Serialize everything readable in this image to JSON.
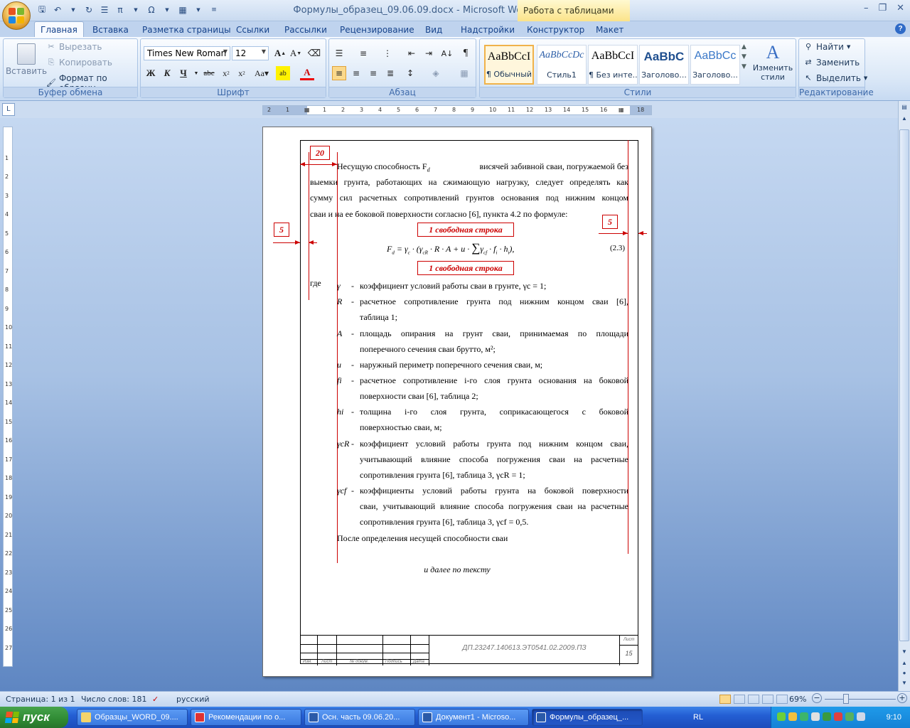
{
  "window": {
    "title": "Формулы_образец_09.06.09.docx - Microsoft Word",
    "context_tab": "Работа с таблицами"
  },
  "tabs": [
    "Главная",
    "Вставка",
    "Разметка страницы",
    "Ссылки",
    "Рассылки",
    "Рецензирование",
    "Вид",
    "Надстройки",
    "Конструктор",
    "Макет"
  ],
  "ribbon": {
    "clipboard": {
      "label": "Буфер обмена",
      "paste": "Вставить",
      "cut": "Вырезать",
      "copy": "Копировать",
      "format": "Формат по образцу"
    },
    "font": {
      "label": "Шрифт",
      "name": "Times New Roman",
      "size": "12"
    },
    "paragraph": {
      "label": "Абзац"
    },
    "styles": {
      "label": "Стили",
      "items": [
        {
          "sample": "AaBbCcI",
          "name": "¶ Обычный"
        },
        {
          "sample": "AaBbCcDc",
          "name": "Стиль1"
        },
        {
          "sample": "AaBbCcI",
          "name": "¶ Без инте..."
        },
        {
          "sample": "AaBbC",
          "name": "Заголово..."
        },
        {
          "sample": "AaBbCc",
          "name": "Заголово..."
        }
      ],
      "change": "Изменить стили"
    },
    "editing": {
      "label": "Редактирование",
      "find": "Найти",
      "replace": "Заменить",
      "select": "Выделить"
    }
  },
  "document": {
    "annotations": {
      "top": "20",
      "left": "5",
      "right": "5",
      "free_line_1": "1 свободная строка",
      "free_line_2": "1 свободная строка"
    },
    "intro_line1": "Несущую способность F",
    "intro_line1_sub": "d",
    "intro_line1_rest": "висячей забивной сваи, погружаемой без",
    "intro_lines": [
      "выемки грунта, работающих на сжимающую нагрузку, следует определять как",
      "сумму сил расчетных сопротивлений грунтов основания под нижним концом",
      "сваи и на ее боковой поверхности согласно [6], пункта 4.2 по формуле:"
    ],
    "formula_number": "(2.3)",
    "where": "где",
    "definitions": [
      {
        "sym": "γ",
        "text": [
          "коэффициент условий работы сваи в грунте, γc = 1;"
        ]
      },
      {
        "sym": "R",
        "text": [
          "расчетное сопротивление грунта под нижним концом сваи [6],",
          "таблица 1;"
        ]
      },
      {
        "sym": "A",
        "text": [
          "площадь опирания на грунт сваи, принимаемая по площади",
          "поперечного сечения сваи брутто, м²;"
        ]
      },
      {
        "sym": "u",
        "text": [
          "наружный периметр поперечного сечения сваи, м;"
        ]
      },
      {
        "sym": "fi",
        "text": [
          "расчетное сопротивление i-го слоя грунта основания на боковой",
          "поверхности сваи [6], таблица 2;"
        ]
      },
      {
        "sym": "hi",
        "text": [
          "толщина i-го слоя грунта, соприкасающегося с боковой",
          "поверхностью сваи, м;"
        ]
      },
      {
        "sym": "γcR",
        "text": [
          "коэффициент условий работы грунта под нижним концом сваи,",
          "учитывающий влияние способа погружения сваи на расчетные",
          "сопротивления грунта [6], таблица 3, γcR = 1;"
        ]
      },
      {
        "sym": "γcf",
        "text": [
          "коэффициенты условий работы грунта на боковой поверхности",
          "сваи, учитывающий влияние способа погружения сваи на расчетные",
          "сопротивления грунта [6], таблица 3, γcf = 0,5."
        ]
      }
    ],
    "after": "После определения несущей способности сваи",
    "continue_note": "и далее по тексту",
    "stamp": {
      "code": "ДП.23247.140613.ЭТ0541.02.2009.ПЗ",
      "sheet_label": "Лист",
      "sheet_num": "15",
      "cols": [
        "Изм.",
        "Лист",
        "№ докум.",
        "Подпись",
        "Дата"
      ]
    }
  },
  "status": {
    "page": "Страница: 1 из 1",
    "words": "Число слов: 181",
    "lang": "русский",
    "zoom": "69%"
  },
  "taskbar": {
    "start": "пуск",
    "tasks": [
      "Образцы_WORD_09....",
      "Рекомендации по о...",
      "Осн. часть 09.06.20...",
      "Документ1 - Microso...",
      "Формулы_образец_..."
    ],
    "lang": "RL",
    "time": "9:10"
  }
}
